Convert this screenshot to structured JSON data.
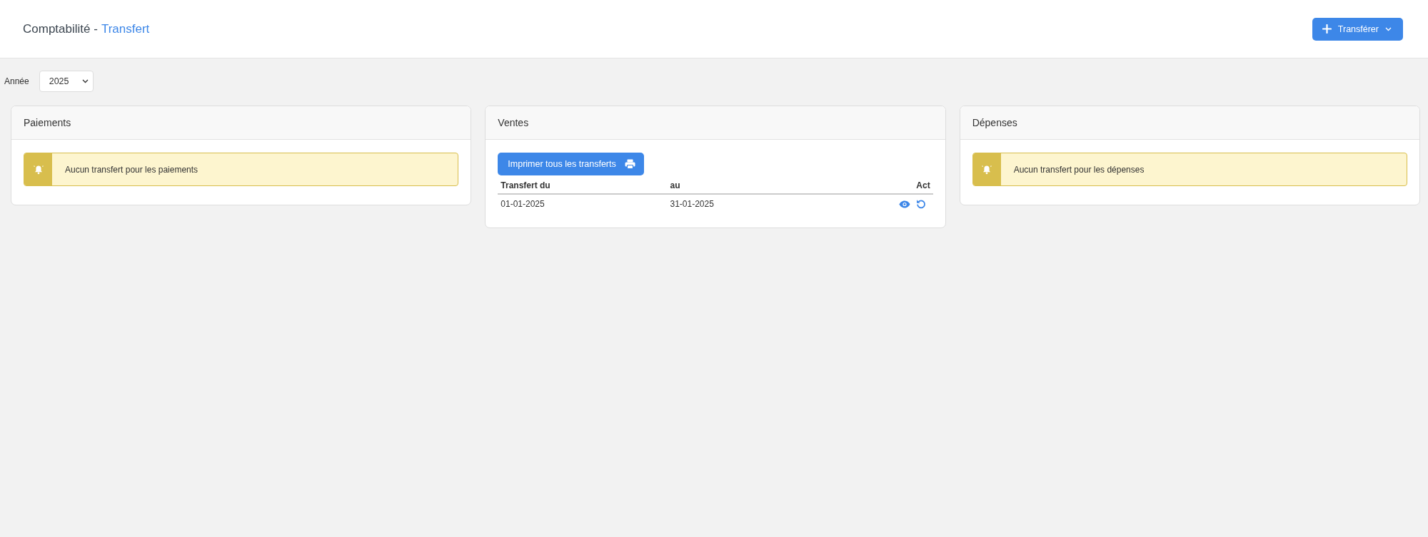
{
  "header": {
    "title": "Comptabilité -",
    "page": "Transfert",
    "action_button": "Transférer"
  },
  "filter": {
    "label": "Année",
    "value": "2025"
  },
  "panels": [
    {
      "kind": "alert",
      "title": "Paiements",
      "message": "Aucun transfert pour les paiements"
    },
    {
      "kind": "table",
      "title": "Ventes",
      "print_button": "Imprimer tous les transferts",
      "columns": [
        "Transfert du",
        "au",
        "Act"
      ],
      "rows": [
        {
          "from": "01-01-2025",
          "to": "31-01-2025"
        }
      ]
    },
    {
      "kind": "alert",
      "title": "Dépenses",
      "message": "Aucun transfert pour les dépenses"
    }
  ]
}
